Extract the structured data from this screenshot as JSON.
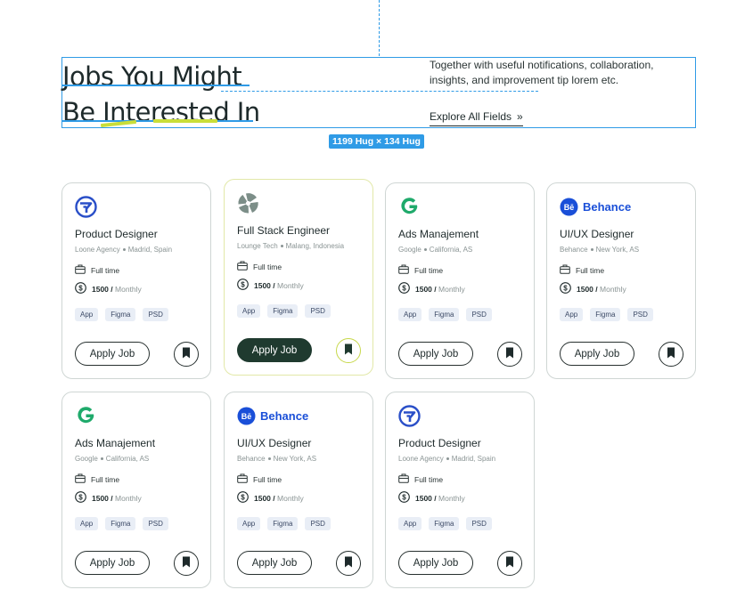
{
  "overlay": {
    "size_badge": "1199 Hug × 134 Hug"
  },
  "header": {
    "title_line1": "Jobs You Might",
    "title_line2": "Be Interested In",
    "description": "Together with useful notifications, collaboration, insights, and improvement tip lorem etc.",
    "explore_label": "Explore All Fields",
    "explore_arrow": "»"
  },
  "colors": {
    "accent_dark_green": "#1f3a2f",
    "highlight_lime": "#c9de3a",
    "selection_blue": "#2f9be6",
    "behance_blue": "#1a4fd8",
    "google_green": "#1faa6b",
    "loone_blue": "#2a4fc8"
  },
  "cards": [
    {
      "logo": "loone-logo-icon",
      "brand_word": "",
      "title": "Product Designer",
      "company": "Loone Agency",
      "location": "Madrid, Spain",
      "type": "Full time",
      "amount": "1500 /",
      "period": "Monthly",
      "tags": [
        "App",
        "Figma",
        "PSD"
      ],
      "apply_label": "Apply Job",
      "active": false
    },
    {
      "logo": "lounge-logo-icon",
      "brand_word": "",
      "title": "Full Stack Engineer",
      "company": "Lounge Tech",
      "location": "Malang, Indonesia",
      "type": "Full time",
      "amount": "1500 /",
      "period": "Monthly",
      "tags": [
        "App",
        "Figma",
        "PSD"
      ],
      "apply_label": "Apply Job",
      "active": true
    },
    {
      "logo": "google-logo-icon",
      "brand_word": "",
      "title": "Ads Manajement",
      "company": "Google",
      "location": "California, AS",
      "type": "Full time",
      "amount": "1500 /",
      "period": "Monthly",
      "tags": [
        "App",
        "Figma",
        "PSD"
      ],
      "apply_label": "Apply Job",
      "active": false
    },
    {
      "logo": "behance-logo-icon",
      "brand_word": "Behance",
      "title": "UI/UX Designer",
      "company": "Behance",
      "location": "New York, AS",
      "type": "Full time",
      "amount": "1500 /",
      "period": "Monthly",
      "tags": [
        "App",
        "Figma",
        "PSD"
      ],
      "apply_label": "Apply Job",
      "active": false
    },
    {
      "logo": "google-logo-icon",
      "brand_word": "",
      "title": "Ads Manajement",
      "company": "Google",
      "location": "California, AS",
      "type": "Full time",
      "amount": "1500 /",
      "period": "Monthly",
      "tags": [
        "App",
        "Figma",
        "PSD"
      ],
      "apply_label": "Apply Job",
      "active": false
    },
    {
      "logo": "behance-logo-icon",
      "brand_word": "Behance",
      "title": "UI/UX Designer",
      "company": "Behance",
      "location": "New York, AS",
      "type": "Full time",
      "amount": "1500 /",
      "period": "Monthly",
      "tags": [
        "App",
        "Figma",
        "PSD"
      ],
      "apply_label": "Apply Job",
      "active": false
    },
    {
      "logo": "loone-logo-icon",
      "brand_word": "",
      "title": "Product Designer",
      "company": "Loone Agency",
      "location": "Madrid, Spain",
      "type": "Full time",
      "amount": "1500 /",
      "period": "Monthly",
      "tags": [
        "App",
        "Figma",
        "PSD"
      ],
      "apply_label": "Apply Job",
      "active": false
    }
  ]
}
